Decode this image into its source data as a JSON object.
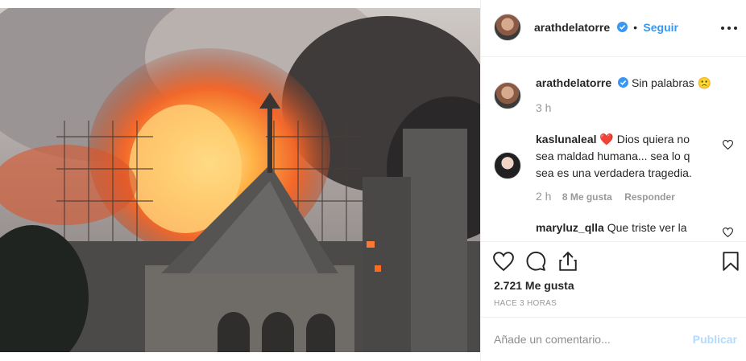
{
  "post": {
    "username": "arathdelatorre",
    "follow_label": "Seguir",
    "dot": "•",
    "caption": "Sin palabras",
    "caption_emoji": "🙁",
    "caption_time": "3 h"
  },
  "comments": [
    {
      "username": "kaslunaleal",
      "emoji": "❤️",
      "text": "Dios quiera no sea maldad humana... sea lo q sea es una verdadera tragedia.",
      "time": "2 h",
      "likes": "8 Me gusta",
      "reply_label": "Responder"
    },
    {
      "username": "maryluz_qlla",
      "text": "Que triste ver la"
    }
  ],
  "actions": {
    "likes_count": "2.721 Me gusta",
    "posted_ago": "HACE 3 HORAS"
  },
  "add_comment": {
    "placeholder": "Añade un comentario...",
    "publish_label": "Publicar"
  },
  "colors": {
    "accent": "#3897f0",
    "publish_disabled": "#b3dbff",
    "emoji_heart": "#d6002f"
  },
  "icons": [
    "verified-badge-icon",
    "more-options-icon",
    "heart-icon",
    "comment-icon",
    "share-icon",
    "bookmark-icon",
    "small-heart-icon"
  ]
}
